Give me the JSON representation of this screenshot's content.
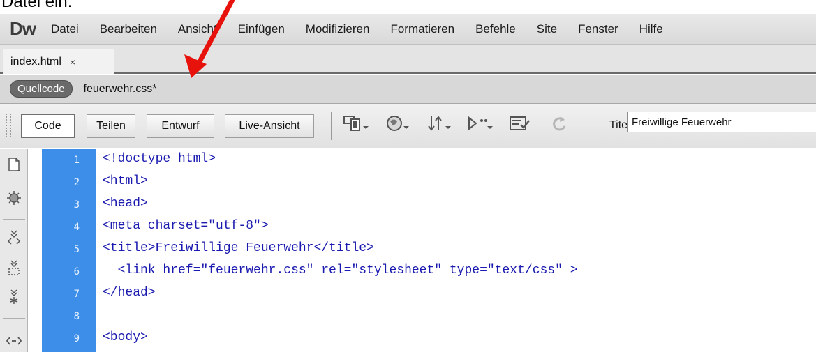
{
  "caption": "Datei ein.",
  "app": {
    "logo": "Dw",
    "menu": [
      "Datei",
      "Bearbeiten",
      "Ansicht",
      "Einfügen",
      "Modifizieren",
      "Formatieren",
      "Befehle",
      "Site",
      "Fenster",
      "Hilfe"
    ]
  },
  "document_tab": {
    "label": "index.html",
    "close": "×"
  },
  "related_files": {
    "source_label": "Quellcode",
    "file": "feuerwehr.css*"
  },
  "toolbar": {
    "views": [
      "Code",
      "Teilen",
      "Entwurf",
      "Live-Ansicht"
    ],
    "active_view": "Code",
    "title_label": "Titel:",
    "title_value": "Freiwillige Feuerwehr",
    "icons": [
      "multiscreen-icon",
      "preview-browser-icon",
      "file-management-icon",
      "visual-aids-icon",
      "validate-icon",
      "refresh-icon"
    ]
  },
  "editor": {
    "line_numbers": [
      "1",
      "2",
      "3",
      "4",
      "5",
      "6",
      "7",
      "8",
      "9"
    ],
    "lines": [
      "<!doctype html>",
      "<html>",
      "<head>",
      "<meta charset=\"utf-8\">",
      "<title>Freiwillige Feuerwehr</title>",
      "  <link href=\"feuerwehr.css\" rel=\"stylesheet\" type=\"text/css\" >",
      "</head>",
      "",
      "<body>"
    ]
  },
  "colors": {
    "gutter": "#3d8ee8",
    "code_text": "#1a1ab0",
    "annotation_arrow": "#e8120c"
  }
}
